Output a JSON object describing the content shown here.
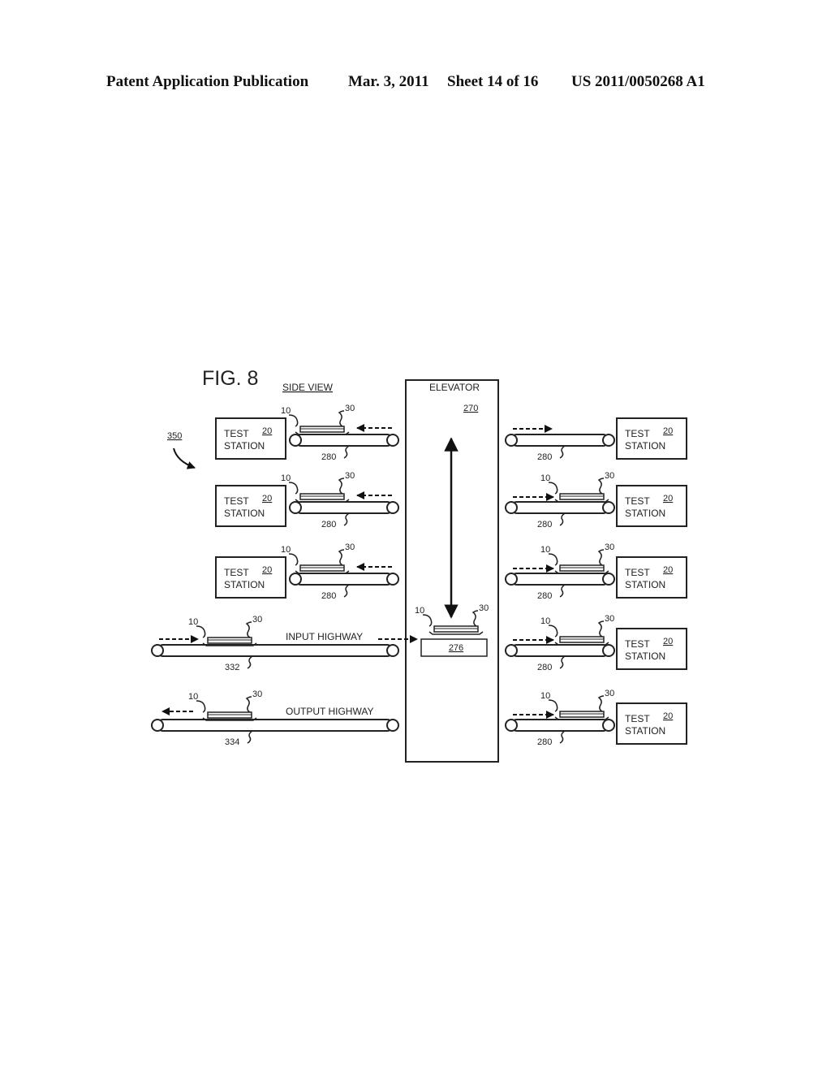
{
  "header": {
    "publication": "Patent Application Publication",
    "date": "Mar. 3, 2011",
    "sheet": "Sheet 14 of 16",
    "number": "US 2011/0050268 A1"
  },
  "figure": {
    "title": "FIG. 8",
    "view_label": "SIDE VIEW",
    "system_ref": "350",
    "elevator": {
      "label": "ELEVATOR",
      "ref": "270",
      "platform_ref": "276"
    },
    "station_label_line1": "TEST",
    "station_label_line2": "STATION",
    "station_ref": "20",
    "conveyor_ref": "280",
    "device_ref": "10",
    "carrier_ref": "30",
    "left_stations": [
      {
        "has_device": true,
        "flow": "toward-station"
      },
      {
        "has_device": true,
        "flow": "toward-station"
      },
      {
        "has_device": true,
        "flow": "toward-station"
      }
    ],
    "right_stations": [
      {
        "has_device": false,
        "flow": "toward-station"
      },
      {
        "has_device": true,
        "flow": "toward-station"
      },
      {
        "has_device": true,
        "flow": "toward-station"
      },
      {
        "has_device": true,
        "flow": "toward-station"
      },
      {
        "has_device": true,
        "flow": "toward-station"
      }
    ],
    "input_highway": {
      "label": "INPUT HIGHWAY",
      "ref": "332"
    },
    "output_highway": {
      "label": "OUTPUT HIGHWAY",
      "ref": "334"
    }
  }
}
